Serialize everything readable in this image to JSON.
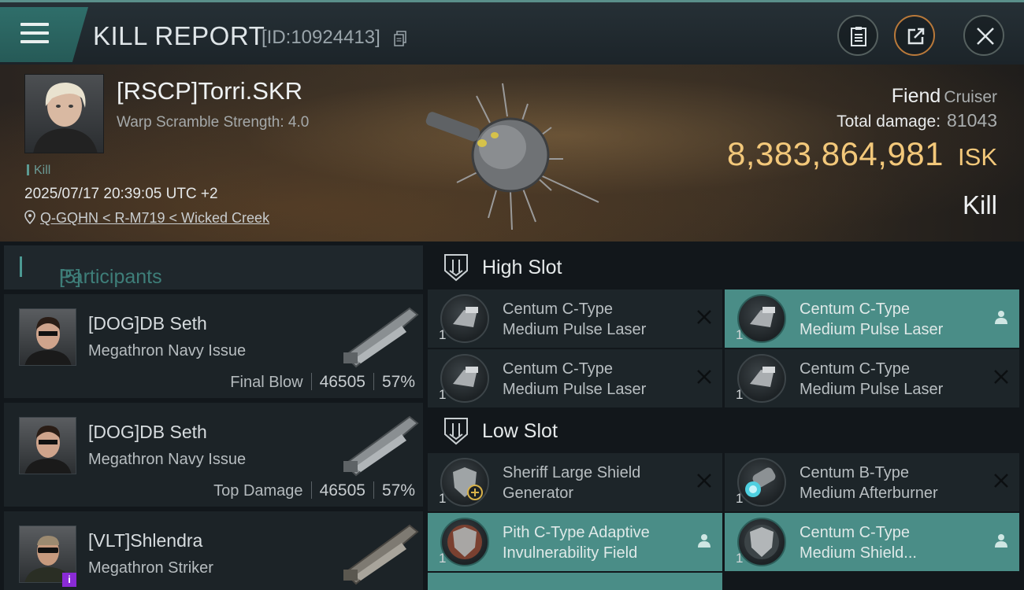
{
  "header": {
    "title": "KILL REPORT",
    "report_id": "[ID:10924413]"
  },
  "victim": {
    "name": "[RSCP]Torri.SKR",
    "warp_scramble": "Warp Scramble Strength: 4.0",
    "tag": "Kill",
    "datetime": "2025/07/17 20:39:05 UTC +2",
    "location": "Q-GQHN < R-M719 < Wicked Creek",
    "ship_name": "Fiend",
    "ship_class": "Cruiser",
    "total_damage_label": "Total damage:",
    "total_damage_value": "81043",
    "isk_value": "8,383,864,981",
    "isk_unit": "ISK",
    "result": "Kill"
  },
  "participants": {
    "label": "Participants",
    "count": "[5]",
    "items": [
      {
        "name": "[DOG]DB Seth",
        "ship": "Megathron Navy Issue",
        "role": "Final Blow",
        "damage": "46505",
        "percent": "57%"
      },
      {
        "name": "[DOG]DB Seth",
        "ship": "Megathron Navy Issue",
        "role": "Top Damage",
        "damage": "46505",
        "percent": "57%"
      },
      {
        "name": "[VLT]Shlendra",
        "ship": "Megathron Striker",
        "role": "",
        "damage": "",
        "percent": ""
      }
    ]
  },
  "slots": {
    "high": {
      "label": "High Slot",
      "modules": [
        {
          "line1": "Centum C-Type",
          "line2": "Medium Pulse Laser",
          "qty": "1",
          "status": "destroyed"
        },
        {
          "line1": "Centum C-Type",
          "line2": "Medium Pulse Laser",
          "qty": "1",
          "status": "dropped"
        },
        {
          "line1": "Centum C-Type",
          "line2": "Medium Pulse Laser",
          "qty": "1",
          "status": "destroyed"
        },
        {
          "line1": "Centum C-Type",
          "line2": "Medium Pulse Laser",
          "qty": "1",
          "status": "destroyed"
        }
      ]
    },
    "low": {
      "label": "Low Slot",
      "modules": [
        {
          "line1": "Sheriff Large Shield",
          "line2": "Generator",
          "qty": "1",
          "status": "destroyed"
        },
        {
          "line1": "Centum B-Type",
          "line2": "Medium Afterburner",
          "qty": "1",
          "status": "destroyed"
        },
        {
          "line1": "Pith C-Type Adaptive",
          "line2": "Invulnerability Field",
          "qty": "1",
          "status": "dropped"
        },
        {
          "line1": "Centum C-Type",
          "line2": "Medium Shield...",
          "qty": "1",
          "status": "dropped"
        }
      ]
    }
  },
  "colors": {
    "accent_teal": "#4a8d87",
    "isk_gold": "#f3c87a",
    "share_orange": "#b9793a"
  }
}
